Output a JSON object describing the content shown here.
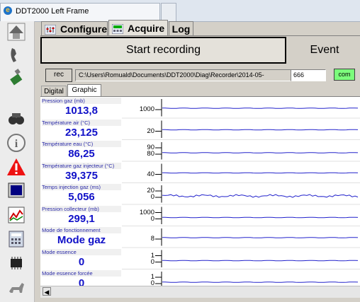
{
  "window": {
    "title": "DDT2000 Left Frame"
  },
  "tabs": [
    {
      "label": "Configure",
      "icon": "configure-icon"
    },
    {
      "label": "Acquire",
      "icon": "acquire-icon"
    },
    {
      "label": "Log"
    }
  ],
  "buttons": {
    "start_recording": "Start recording",
    "event": "Event"
  },
  "status": {
    "rec": "rec",
    "path": "C:\\Users\\Romuald\\Documents\\DDT2000\\Diag\\Recorder\\2014-05-",
    "number": "666",
    "com": "com",
    "com_color": "#7cfc7c"
  },
  "subtabs": [
    "Digital",
    "Graphic"
  ],
  "active_subtab": "Graphic",
  "channels": [
    {
      "label": "Pression gaz (mb)",
      "value": "1013,8",
      "ticks": [
        "1000"
      ],
      "trace": "flat"
    },
    {
      "label": "Température air (°C)",
      "value": "23,125",
      "ticks": [
        "20"
      ],
      "trace": "flat"
    },
    {
      "label": "Température eau (°C)",
      "value": "86,25",
      "ticks": [
        "90",
        "80"
      ],
      "trace": "flat"
    },
    {
      "label": "Température gaz injecteur (°C)",
      "value": "39,375",
      "ticks": [
        "40"
      ],
      "trace": "flat"
    },
    {
      "label": "Temps injection gaz (ms)",
      "value": "5,056",
      "ticks": [
        "20",
        "0"
      ],
      "trace": "noisy"
    },
    {
      "label": "Pression collecteur (mb)",
      "value": "299,1",
      "ticks": [
        "1000",
        "0"
      ],
      "trace": "flat"
    },
    {
      "label": "Mode de fonctionnement",
      "value": "Mode gaz",
      "ticks": [
        "8"
      ],
      "trace": "flat"
    },
    {
      "label": "Mode essence",
      "value": "0",
      "ticks": [
        "1",
        "0"
      ],
      "trace": "flat"
    },
    {
      "label": "Mode essence forcée",
      "value": "0",
      "ticks": [
        "1",
        "0"
      ],
      "trace": "flat"
    }
  ],
  "sidebar_icons": [
    "home-icon",
    "phone-icon",
    "usb-plug-icon",
    "binoculars-icon",
    "info-icon",
    "warning-icon",
    "monitor-icon",
    "chart-icon",
    "calculator-icon",
    "chip-icon",
    "dog-icon"
  ],
  "colors": {
    "value_text": "#1010c8",
    "trace": "#2222cc",
    "label_text": "#2a2aa8"
  }
}
